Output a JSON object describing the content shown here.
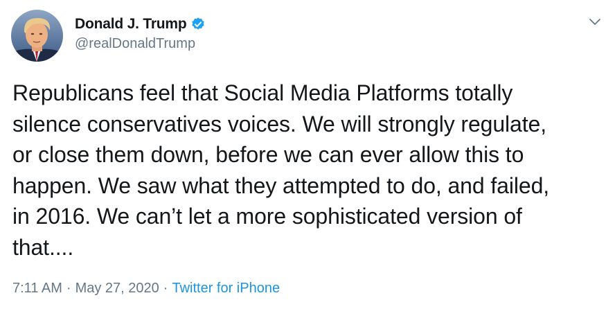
{
  "author": {
    "display_name": "Donald J. Trump",
    "handle": "@realDonaldTrump",
    "verified": true
  },
  "tweet": {
    "text": "Republicans feel that Social Media Platforms totally\nsilence conservatives voices. We will strongly regulate,\nor close them down, before we can ever allow this to\nhappen. We saw what they attempted to do, and failed,\nin 2016. We can’t let a more sophisticated version of\nthat....",
    "time": "7:11 AM",
    "date": "May 27, 2020",
    "separator": "·",
    "source": "Twitter for iPhone"
  },
  "icons": {
    "verified": "verified-badge-icon",
    "menu": "chevron-down-icon"
  },
  "colors": {
    "text_primary": "#14171a",
    "text_secondary": "#657786",
    "link": "#1b95e0",
    "verified_blue": "#1da1f2"
  }
}
